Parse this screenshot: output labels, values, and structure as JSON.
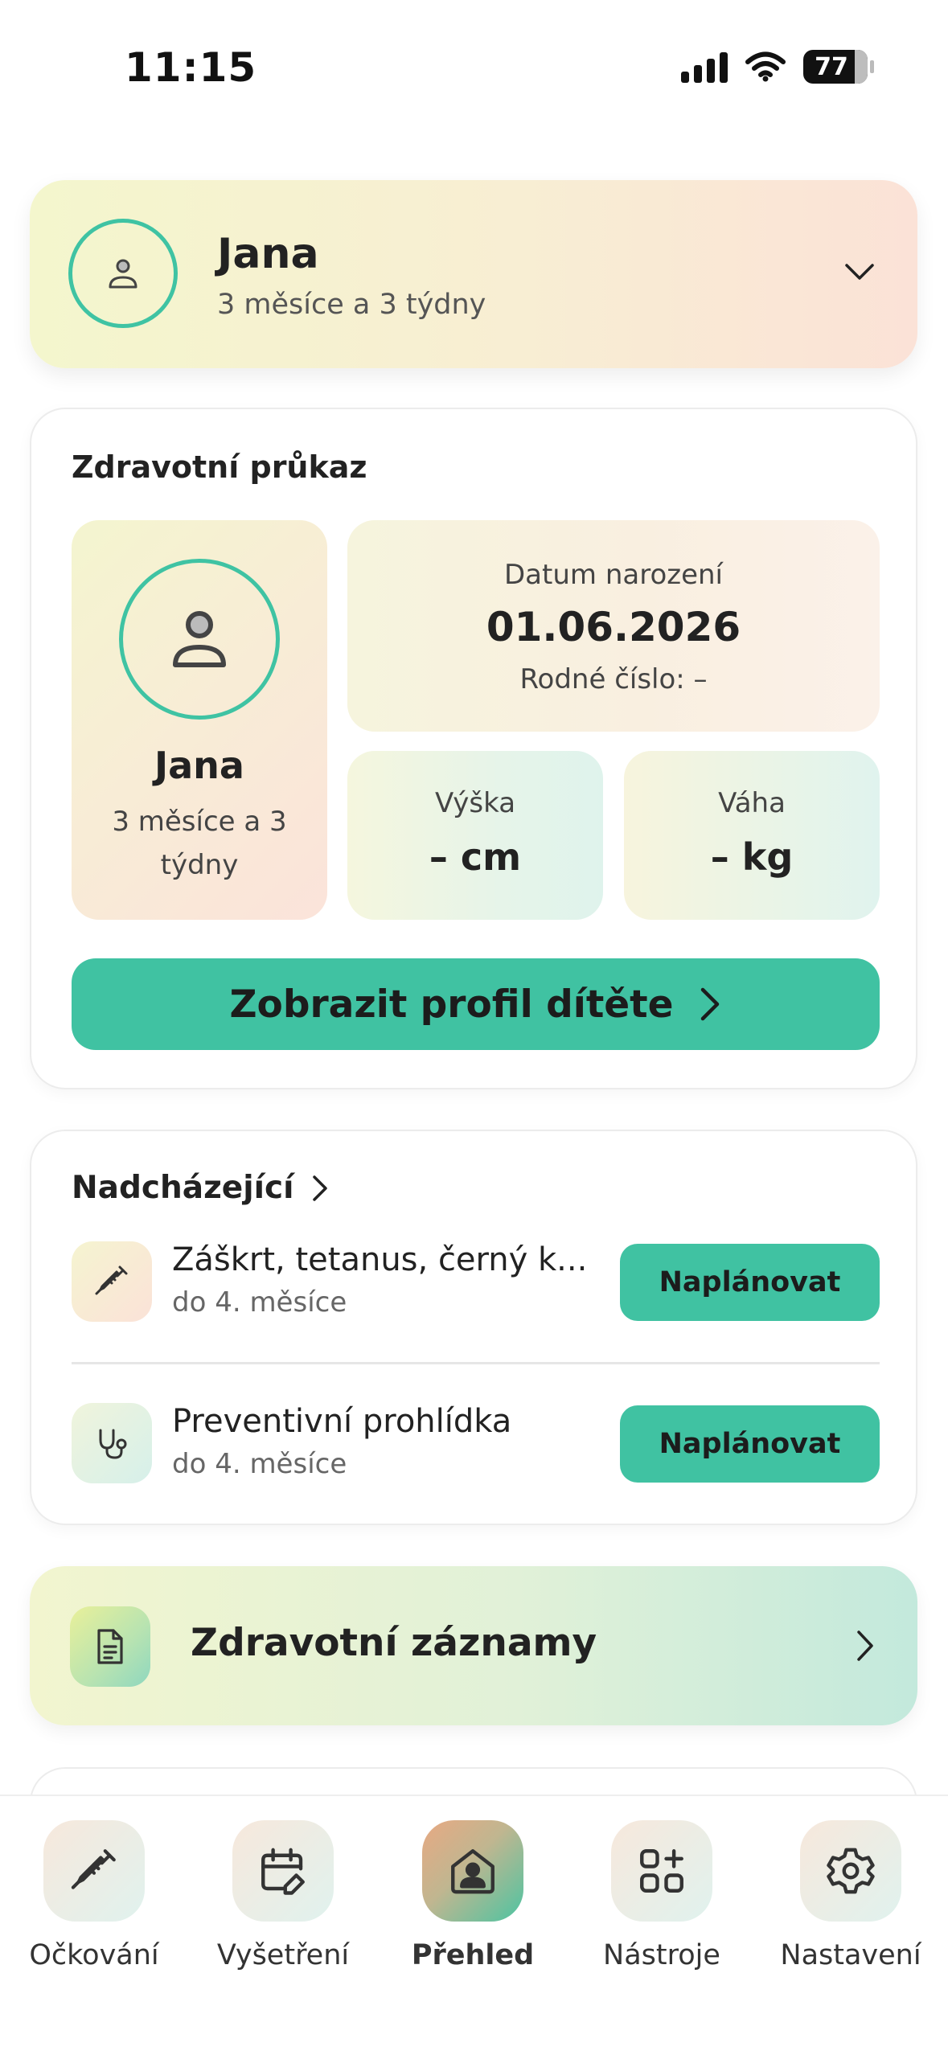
{
  "status_bar": {
    "time": "11:15",
    "battery": "77"
  },
  "child_selector": {
    "name": "Jana",
    "age": "3 měsíce a 3 týdny"
  },
  "health_card": {
    "title": "Zdravotní průkaz",
    "profile_name": "Jana",
    "profile_age": "3 měsíce a 3 týdny",
    "birth_label": "Datum narození",
    "birth_date": "01.06.2026",
    "birth_number": "Rodné číslo: –",
    "height_label": "Výška",
    "height_value": "– cm",
    "weight_label": "Váha",
    "weight_value": "– kg",
    "profile_button": "Zobrazit profil dítěte"
  },
  "upcoming": {
    "title": "Nadcházející",
    "items": [
      {
        "title": "Záškrt, tetanus, černý k...",
        "due": "do 4. měsíce",
        "action": "Naplánovat",
        "icon": "syringe-icon"
      },
      {
        "title": "Preventivní prohlídka",
        "due": "do 4. měsíce",
        "action": "Naplánovat",
        "icon": "stethoscope-icon"
      }
    ]
  },
  "records": {
    "title": "Zdravotní záznamy",
    "icon": "document-icon"
  },
  "tabs": [
    {
      "label": "Očkování",
      "icon": "syringe-icon",
      "active": false
    },
    {
      "label": "Vyšetření",
      "icon": "calendar-edit-icon",
      "active": false
    },
    {
      "label": "Přehled",
      "icon": "home-profile-icon",
      "active": true
    },
    {
      "label": "Nástroje",
      "icon": "tools-grid-icon",
      "active": false
    },
    {
      "label": "Nastavení",
      "icon": "gear-icon",
      "active": false
    }
  ],
  "colors": {
    "accent": "#40c2a2",
    "text": "#222222"
  }
}
